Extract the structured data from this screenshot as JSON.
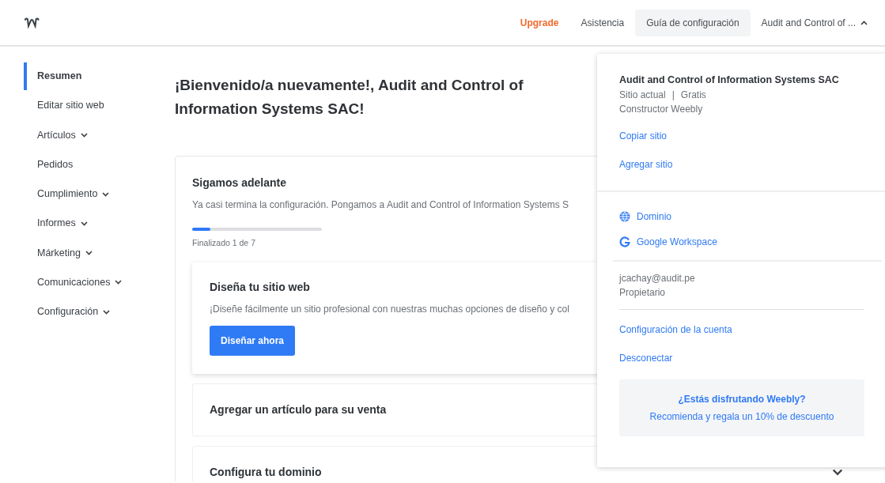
{
  "header": {
    "nav": [
      {
        "label": "Upgrade",
        "kind": "upgrade",
        "selected": false
      },
      {
        "label": "Asistencia",
        "kind": "link",
        "selected": false
      },
      {
        "label": "Guía de configuración",
        "kind": "link",
        "selected": true
      },
      {
        "label": "Audit and Control of ...",
        "kind": "account",
        "selected": false,
        "expanded": true
      }
    ]
  },
  "sidebar": {
    "items": [
      {
        "label": "Resumen",
        "selected": true,
        "expandable": false
      },
      {
        "label": "Editar sitio web",
        "selected": false,
        "expandable": false
      },
      {
        "label": "Artículos",
        "selected": false,
        "expandable": true
      },
      {
        "label": "Pedidos",
        "selected": false,
        "expandable": false
      },
      {
        "label": "Cumplimiento",
        "selected": false,
        "expandable": true
      },
      {
        "label": "Informes",
        "selected": false,
        "expandable": true
      },
      {
        "label": "Márketing",
        "selected": false,
        "expandable": true
      },
      {
        "label": "Comunicaciones",
        "selected": false,
        "expandable": true
      },
      {
        "label": "Configuración",
        "selected": false,
        "expandable": true
      }
    ]
  },
  "main": {
    "heading": "¡Bienvenido/a nuevamente!, Audit and Control of Information Systems SAC!",
    "setup": {
      "title": "Sigamos adelante",
      "subtitle": "Ya casi termina la configuración. Pongamos a Audit and Control of Information Systems S",
      "level": 0.14,
      "progress_text": "Finalizado 1 de 7",
      "steps": [
        {
          "title": "Diseña tu sitio web",
          "expanded": true,
          "description": "¡Diseñe fácilmente un sitio profesional con nuestras muchas opciones de diseño y col",
          "button": "Diseñar ahora"
        },
        {
          "title": "Agregar un artículo para su venta",
          "expanded": false
        },
        {
          "title": "Configura tu dominio",
          "expanded": false,
          "show_chevron": true
        }
      ]
    }
  },
  "account_menu": {
    "site_name": "Audit and Control of Information Systems SAC",
    "site_status": "Sitio actual",
    "separator": "|",
    "plan": "Gratis",
    "builder": "Constructor Weebly",
    "site_links": [
      "Copiar sitio",
      "Agregar sitio"
    ],
    "services": [
      {
        "label": "Dominio",
        "kind": "globe"
      },
      {
        "label": "Google Workspace",
        "kind": "google"
      }
    ],
    "email": "jcachay@audit.pe",
    "role": "Propietario",
    "account_links": [
      "Configuración de la cuenta",
      "Desconectar"
    ],
    "promo": {
      "title": "¿Estás disfrutando Weebly?",
      "text": "Recomienda y regala un 10% de descuento"
    }
  }
}
